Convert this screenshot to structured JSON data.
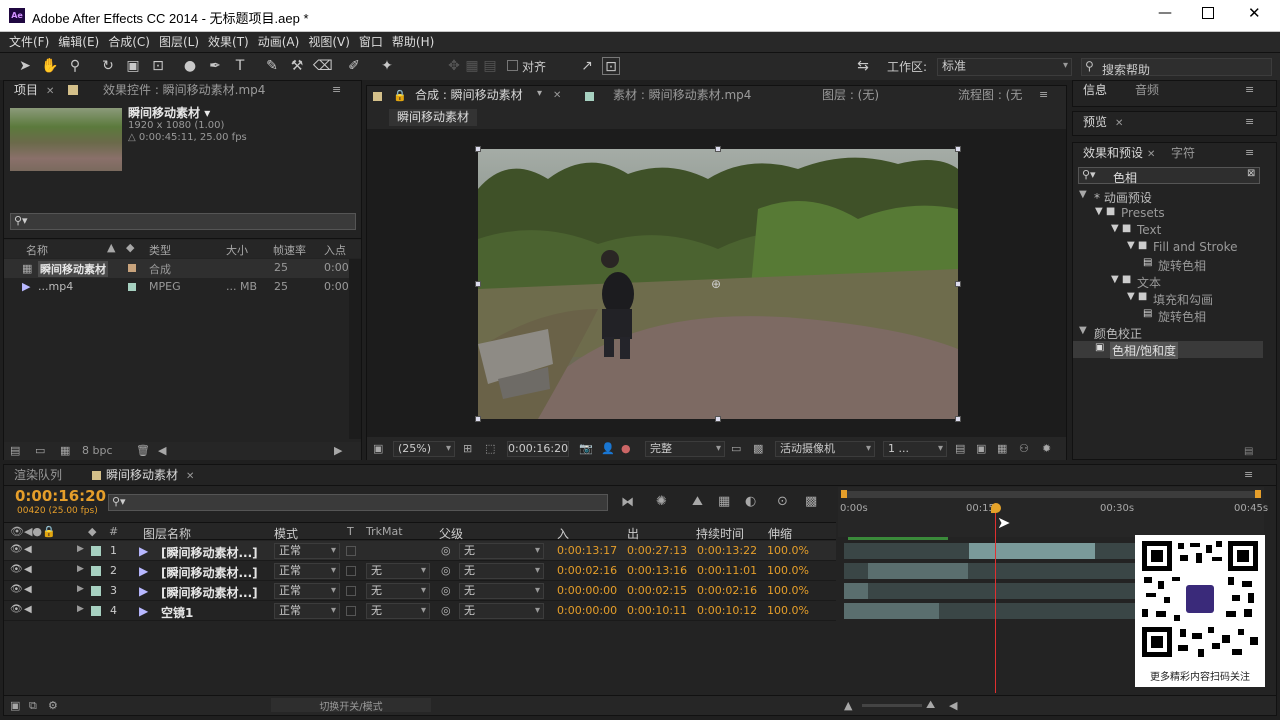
{
  "window": {
    "title": "Adobe After Effects CC 2014 - 无标题项目.aep *",
    "app_badge": "Ae"
  },
  "menu": [
    "文件(F)",
    "编辑(E)",
    "合成(C)",
    "图层(L)",
    "效果(T)",
    "动画(A)",
    "视图(V)",
    "窗口",
    "帮助(H)"
  ],
  "toolbar": {
    "snap_label": "对齐",
    "workspace_label": "工作区:",
    "workspace_value": "标准",
    "help_placeholder": "搜索帮助"
  },
  "project_panel": {
    "tabs": [
      "项目",
      "效果控件 : 瞬间移动素材.mp4"
    ],
    "selected_name": "瞬间移动素材",
    "info_line1": "1920 x 1080 (1.00)",
    "info_line2": "△ 0:00:45:11, 25.00 fps",
    "columns": [
      "名称",
      "类型",
      "大小",
      "帧速率",
      "入点"
    ],
    "items": [
      {
        "name": "瞬间移动素材",
        "type": "合成",
        "size": "",
        "fps": "25",
        "in": "0:00"
      },
      {
        "name": "...mp4",
        "type": "MPEG",
        "size": "... MB",
        "fps": "25",
        "in": "0:00"
      }
    ],
    "bpc": "8 bpc"
  },
  "comp_panel": {
    "tabs": [
      "合成 : 瞬间移动素材",
      "素材 : 瞬间移动素材.mp4",
      "图层 : (无)",
      "流程图 : (无"
    ],
    "breadcrumb": "瞬间移动素材",
    "zoom": "(25%)",
    "timecode": "0:00:16:20",
    "resolution": "完整",
    "camera": "活动摄像机",
    "views": "1 ..."
  },
  "right_panels": {
    "info_tabs": [
      "信息",
      "音频"
    ],
    "preview_tab": "预览",
    "effects_tabs": [
      "效果和预设",
      "字符"
    ],
    "search_value": "色相",
    "tree": [
      {
        "label": "* 动画预设",
        "level": 0,
        "kind": "twirl"
      },
      {
        "label": "Presets",
        "level": 1,
        "kind": "folder"
      },
      {
        "label": "Text",
        "level": 2,
        "kind": "folder"
      },
      {
        "label": "Fill and Stroke",
        "level": 3,
        "kind": "folder"
      },
      {
        "label": "旋转色相",
        "level": 4,
        "kind": "preset"
      },
      {
        "label": "文本",
        "level": 2,
        "kind": "folder"
      },
      {
        "label": "填充和勾画",
        "level": 3,
        "kind": "folder"
      },
      {
        "label": "旋转色相",
        "level": 4,
        "kind": "preset"
      },
      {
        "label": "颜色校正",
        "level": 0,
        "kind": "twirl"
      },
      {
        "label": "色相/饱和度",
        "level": 1,
        "kind": "effect"
      }
    ]
  },
  "timeline": {
    "tabs": [
      "渲染队列",
      "瞬间移动素材"
    ],
    "timecode": "0:00:16:20",
    "frame_info": "00420 (25.00 fps)",
    "columns": [
      "#",
      "图层名称",
      "模式",
      "T",
      "TrkMat",
      "父级",
      "入",
      "出",
      "持续时间",
      "伸缩"
    ],
    "ruler": [
      "0:00s",
      "00:15s",
      "00:30s",
      "00:45s"
    ],
    "layers": [
      {
        "num": "1",
        "name": "[瞬间移动素材...]",
        "mode": "正常",
        "trkmat": "",
        "parent": "无",
        "in": "0:00:13:17",
        "out": "0:00:27:13",
        "dur": "0:00:13:22",
        "stretch": "100.0%"
      },
      {
        "num": "2",
        "name": "[瞬间移动素材...]",
        "mode": "正常",
        "trkmat": "无",
        "parent": "无",
        "in": "0:00:02:16",
        "out": "0:00:13:16",
        "dur": "0:00:11:01",
        "stretch": "100.0%"
      },
      {
        "num": "3",
        "name": "[瞬间移动素材...]",
        "mode": "正常",
        "trkmat": "无",
        "parent": "无",
        "in": "0:00:00:00",
        "out": "0:00:02:15",
        "dur": "0:00:02:16",
        "stretch": "100.0%"
      },
      {
        "num": "4",
        "name": "空镜1",
        "mode": "正常",
        "trkmat": "无",
        "parent": "无",
        "in": "0:00:00:00",
        "out": "0:00:10:11",
        "dur": "0:00:10:12",
        "stretch": "100.0%"
      }
    ],
    "footer": "切换开关/模式",
    "qr_caption": "更多精彩内容扫码关注"
  },
  "colors": {
    "accent": "#e59e2a",
    "bg": "#232323",
    "playhead": "#e03030"
  }
}
